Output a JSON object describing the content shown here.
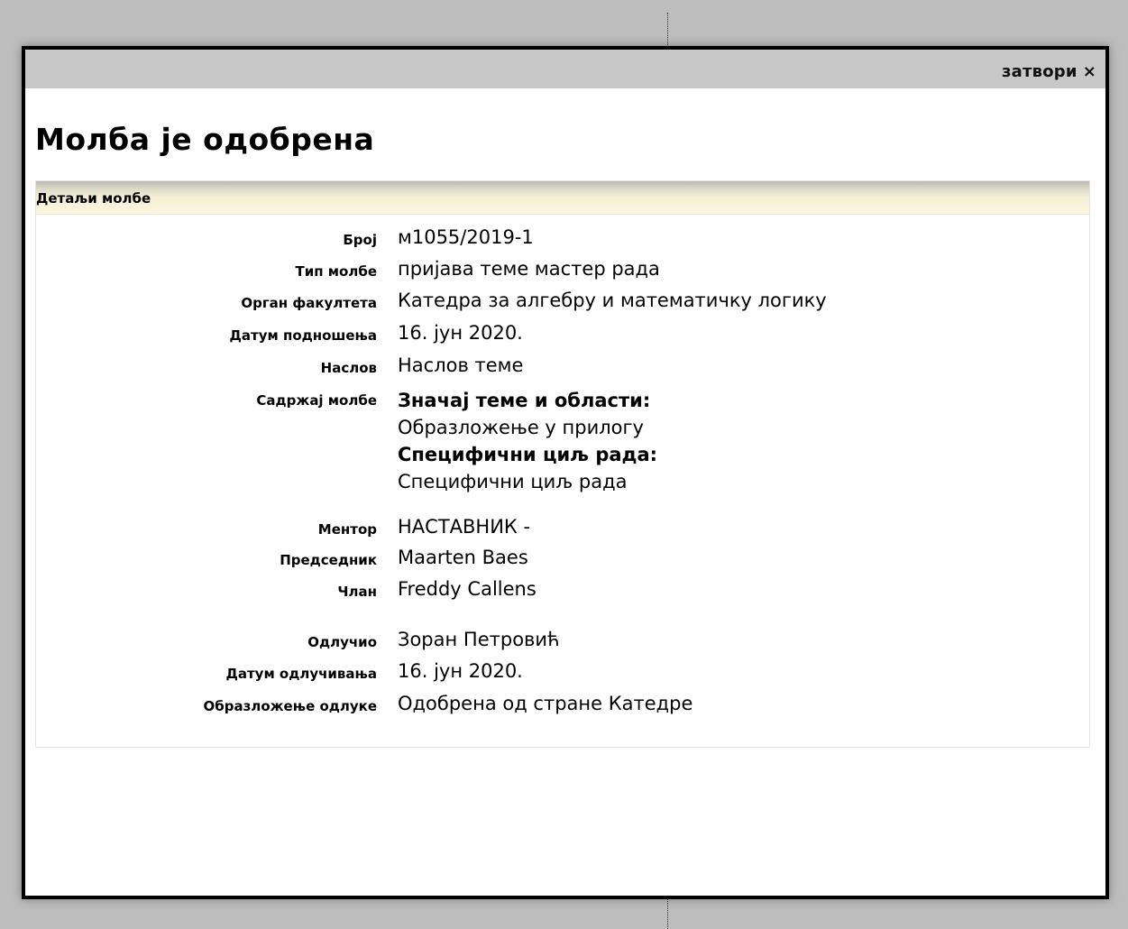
{
  "dialog": {
    "close_label": "затвори",
    "close_symbol": "×",
    "title": "Молба је одобрена"
  },
  "details": {
    "header": "Детаљи молбе",
    "fields": [
      {
        "label": "Број",
        "value": "м1055/2019-1"
      },
      {
        "label": "Тип молбе",
        "value": "пријава теме мастер рада"
      },
      {
        "label": "Орган факултета",
        "value": "Катедра за алгебру и математичку логику"
      },
      {
        "label": "Датум подношења",
        "value": "16. јун 2020."
      },
      {
        "label": "Наслов",
        "value": "Наслов теме"
      }
    ],
    "content": {
      "label": "Садржај молбе",
      "heading1": "Значај теме и области:",
      "text1": "Образложење у прилогу",
      "heading2": "Специфични циљ рада:",
      "text2": "Специфични циљ рада"
    },
    "committee": [
      {
        "label": "Ментор",
        "value": "НАСТАВНИК -"
      },
      {
        "label": "Председник",
        "value": "Maarten Baes"
      },
      {
        "label": "Члан",
        "value": "Freddy Callens"
      }
    ],
    "decision": [
      {
        "label": "Одлучио",
        "value": "Зоран Петровић"
      },
      {
        "label": "Датум одлучивања",
        "value": "16. јун 2020."
      },
      {
        "label": "Образложење одлуке",
        "value": "Одобрена од стране Катедре"
      }
    ]
  }
}
